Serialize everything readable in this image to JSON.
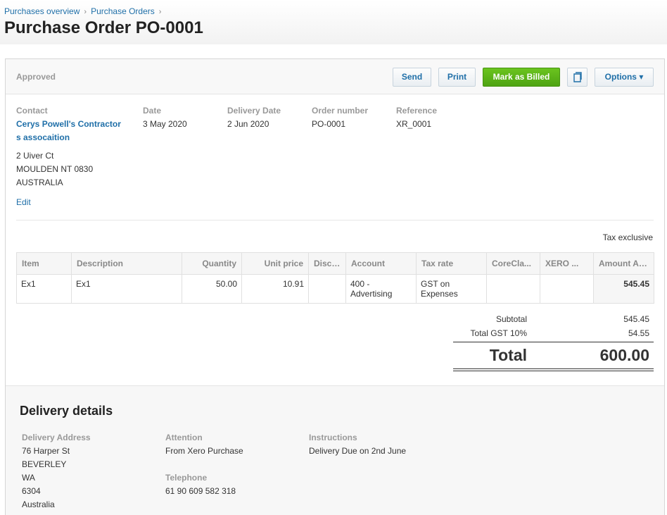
{
  "breadcrumb": {
    "items": [
      "Purchases overview",
      "Purchase Orders"
    ],
    "separator": "›"
  },
  "page": {
    "title": "Purchase Order PO-0001"
  },
  "toolbar": {
    "status": "Approved",
    "send_label": "Send",
    "print_label": "Print",
    "mark_billed_label": "Mark as Billed",
    "copy_icon": "copy-icon",
    "options_label": "Options ▾"
  },
  "fields": {
    "contact_label": "Contact",
    "contact_line1": "Cerys Powell's Contractor",
    "contact_line2": "s assocaition",
    "date_label": "Date",
    "date_value": "3 May 2020",
    "delivery_date_label": "Delivery Date",
    "delivery_date_value": "2 Jun 2020",
    "order_number_label": "Order number",
    "order_number_value": "PO-0001",
    "reference_label": "Reference",
    "reference_value": "XR_0001",
    "address_lines": [
      "2 Uiver Ct",
      "MOULDEN NT 0830",
      "AUSTRALIA"
    ],
    "edit_label": "Edit"
  },
  "tax_mode": "Tax exclusive",
  "table": {
    "headers": [
      "Item",
      "Description",
      "Quantity",
      "Unit price",
      "Disc %",
      "Account",
      "Tax rate",
      "CoreCla...",
      "XERO ...",
      "Amount AUD"
    ],
    "rows": [
      {
        "item": "Ex1",
        "description": "Ex1",
        "quantity": "50.00",
        "unit_price": "10.91",
        "disc": "",
        "account_1": "400 -",
        "account_2": "Advertising",
        "tax_1": "GST on",
        "tax_2": "Expenses",
        "core": "",
        "xero": "",
        "amount": "545.45"
      }
    ]
  },
  "totals": {
    "subtotal_label": "Subtotal",
    "subtotal_value": "545.45",
    "gst_label": "Total GST 10%",
    "gst_value": "54.55",
    "total_label": "Total",
    "total_value": "600.00"
  },
  "delivery": {
    "title": "Delivery details",
    "address_label": "Delivery Address",
    "address_lines": [
      "76 Harper St",
      "BEVERLEY",
      "WA",
      "6304",
      "Australia"
    ],
    "attention_label": "Attention",
    "attention_value": "From Xero Purchase",
    "telephone_label": "Telephone",
    "telephone_value": "61 90 609 582 318",
    "instructions_label": "Instructions",
    "instructions_value": "Delivery Due on 2nd June"
  },
  "colors": {
    "link": "#1f6fa8",
    "accent_green": "#5cb519",
    "muted": "#999999"
  }
}
